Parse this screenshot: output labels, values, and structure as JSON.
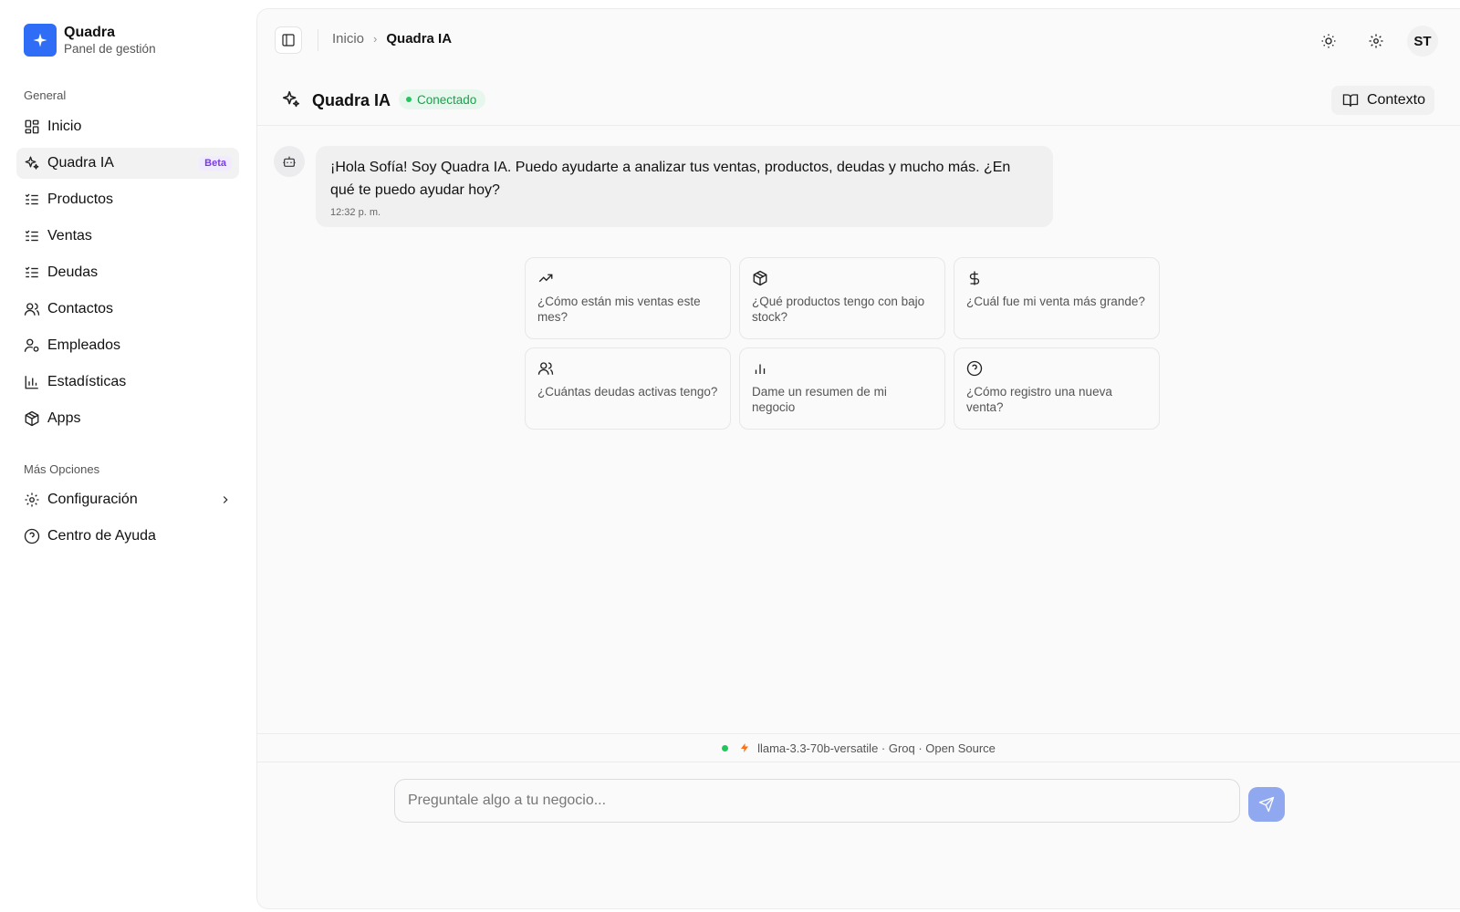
{
  "brand": {
    "title": "Quadra",
    "subtitle": "Panel de gestión"
  },
  "sidebar": {
    "general_label": "General",
    "items": [
      {
        "label": "Inicio",
        "icon": "dashboard-icon"
      },
      {
        "label": "Quadra IA",
        "icon": "sparkles-icon",
        "badge": "Beta",
        "active": true
      },
      {
        "label": "Productos",
        "icon": "list-checks-icon"
      },
      {
        "label": "Ventas",
        "icon": "list-checks-icon"
      },
      {
        "label": "Deudas",
        "icon": "list-checks-icon"
      },
      {
        "label": "Contactos",
        "icon": "users-icon"
      },
      {
        "label": "Empleados",
        "icon": "user-cog-icon"
      },
      {
        "label": "Estadísticas",
        "icon": "bar-chart-icon"
      },
      {
        "label": "Apps",
        "icon": "package-icon"
      }
    ],
    "more_label": "Más Opciones",
    "more_items": [
      {
        "label": "Configuración",
        "icon": "gear-icon"
      },
      {
        "label": "Centro de Ayuda",
        "icon": "help-circle-icon"
      }
    ]
  },
  "topbar": {
    "breadcrumb": {
      "home": "Inicio",
      "current": "Quadra IA"
    },
    "avatar_initials": "ST"
  },
  "chat": {
    "title": "Quadra IA",
    "status": "Conectado",
    "context_label": "Contexto",
    "message": {
      "text": "¡Hola Sofía! Soy Quadra IA. Puedo ayudarte a analizar tus ventas, productos, deudas y mucho más. ¿En qué te puedo ayudar hoy?",
      "time": "12:32 p. m."
    },
    "suggestions": [
      {
        "icon": "trending-up-icon",
        "text": "¿Cómo están mis ventas este mes?"
      },
      {
        "icon": "package-icon",
        "text": "¿Qué productos tengo con bajo stock?"
      },
      {
        "icon": "dollar-icon",
        "text": "¿Cuál fue mi venta más grande?"
      },
      {
        "icon": "users-icon",
        "text": "¿Cuántas deudas activas tengo?"
      },
      {
        "icon": "bar-chart-icon",
        "text": "Dame un resumen de mi negocio"
      },
      {
        "icon": "help-circle-icon",
        "text": "¿Cómo registro una nueva venta?"
      }
    ],
    "model_info": "llama-3.3-70b-versatile · Groq · Open Source",
    "input_placeholder": "Preguntale algo a tu negocio...",
    "input_value": ""
  },
  "colors": {
    "brand_blue": "#2f6df6",
    "status_green": "#22c55e",
    "beta_purple": "#7c3aed",
    "send_button": "#8fa8f0",
    "bolt_orange": "#f97316"
  }
}
